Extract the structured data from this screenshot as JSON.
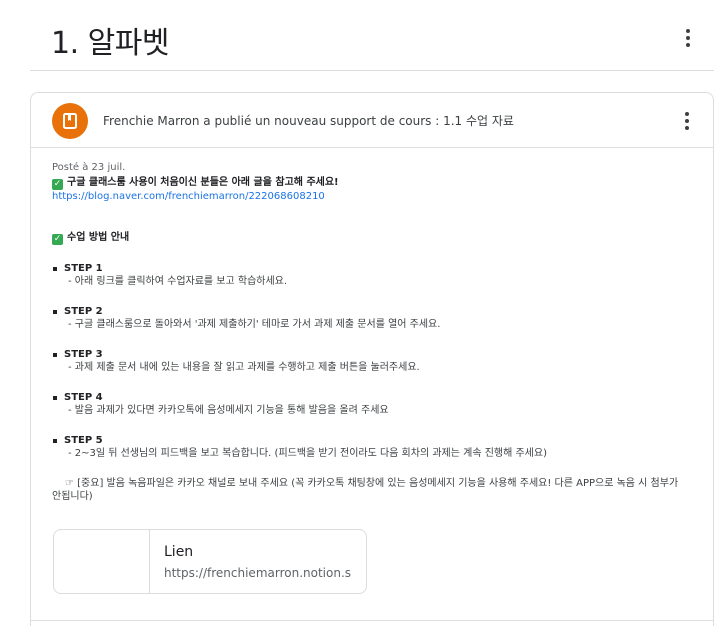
{
  "topic": {
    "title": "1. 알파벳"
  },
  "post": {
    "headline": "Frenchie Marron a publié un nouveau support de cours : 1.1 수업 자료",
    "posted": "Posté à 23 juil.",
    "intro": "구글 클래스룸 사용이 처음이신 분들은 아래 글을 참고해 주세요!",
    "intro_link": "https://blog.naver.com/frenchiemarron/222068608210",
    "section_title": "수업 방법 안내",
    "steps": [
      {
        "title": "STEP 1",
        "desc": "- 아래 링크를 클릭하여 수업자료를 보고 학습하세요."
      },
      {
        "title": "STEP 2",
        "desc": "- 구글 클래스룸으로 돌아와서 '과제 제출하기' 테마로 가서 과제 제출 문서를 열어 주세요."
      },
      {
        "title": "STEP 3",
        "desc": "- 과제 제출 문서 내에 있는 내용을 잘 읽고 과제를 수행하고 제출 버튼을 눌러주세요."
      },
      {
        "title": "STEP 4",
        "desc": "- 발음 과제가 있다면 카카오톡에 음성메세지 기능을 통해 발음을 올려 주세요"
      },
      {
        "title": "STEP 5",
        "desc": "- 2~3일 뒤 선생님의 피드백을 보고 복습합니다. (피드백을 받기 전이라도 다음 회차의 과제는 계속 진행해 주세요)"
      }
    ],
    "note": "☞ [중요] 발음 녹음파일은 카카오 채널로 보내 주세요 (꼭 카카오톡 채팅창에 있는 음성메세지 기능을 사용해 주세요! 다른 APP으로 녹음 시 첨부가 안됩니다)",
    "attachment": {
      "title": "Lien",
      "url": "https://frenchiemarron.notion.s"
    }
  },
  "colors": {
    "avatar": "#e8710a",
    "check": "#34a853",
    "link": "#1a73e8"
  },
  "icons": {
    "avatar": "book-icon",
    "check": "checkbox-checked-icon",
    "menu": "more-vert-icon"
  }
}
